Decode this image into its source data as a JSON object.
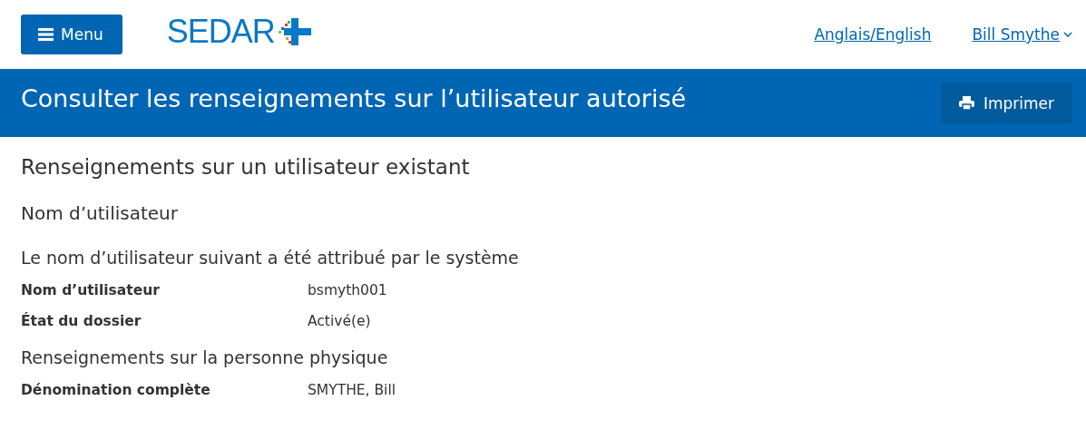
{
  "header": {
    "menu_button": "Menu",
    "logo": "SEDAR",
    "language_link": "Anglais/English",
    "user_menu": "Bill Smythe"
  },
  "banner": {
    "title": "Consulter les renseignements sur l’utilisateur autorisé",
    "print_button": "Imprimer"
  },
  "content": {
    "heading": "Renseignements sur un utilisateur existant",
    "section_title": "Nom d’utilisateur",
    "groups": [
      {
        "title": "Le nom d’utilisateur suivant a été attribué par le système",
        "fields": [
          {
            "label": "Nom d’utilisateur",
            "value": "bsmyth001"
          },
          {
            "label": "État du dossier",
            "value": "Activé(e)"
          }
        ]
      },
      {
        "title": "Renseignements sur la personne physique",
        "fields": [
          {
            "label": "Dénomination complète",
            "value": "SMYTHE, Bill"
          }
        ]
      }
    ]
  }
}
